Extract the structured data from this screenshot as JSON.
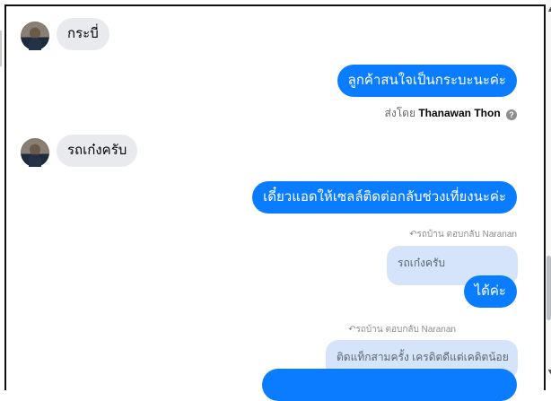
{
  "conversation": {
    "messages": [
      {
        "from": "customer",
        "text": "กระบี่"
      },
      {
        "from": "agent",
        "text": "ลูกค้าสนใจเป็นกระบะนะค่ะ"
      },
      {
        "from": "customer",
        "text": "รถเก๋งครับ"
      },
      {
        "from": "agent",
        "text": "เดี๋ยวแอดให้เซลล์ติดต่อกลับช่วงเที่ยงนะค่ะ"
      },
      {
        "from": "agent",
        "text": "ได้ค่ะ"
      }
    ],
    "sent_by": {
      "prefix": "ส่งโดย",
      "name": "Thanawan Thon",
      "icon": "info-icon"
    },
    "replies": [
      {
        "label": "รถบ้าน ตอบกลับ Naranan",
        "quote": "รถเก๋งครับ",
        "icon": "reply-arrow-icon"
      },
      {
        "label": "รถบ้าน ตอบกลับ Naranan",
        "quote": "ติดแท็กสามครั้ง เครดิตดีแต่เคดิตน้อย",
        "icon": "reply-arrow-icon"
      }
    ]
  },
  "colors": {
    "outgoing_bubble": "#0a7cff",
    "incoming_bubble": "#e9eaed",
    "reply_quote": "#d5e3fb"
  }
}
